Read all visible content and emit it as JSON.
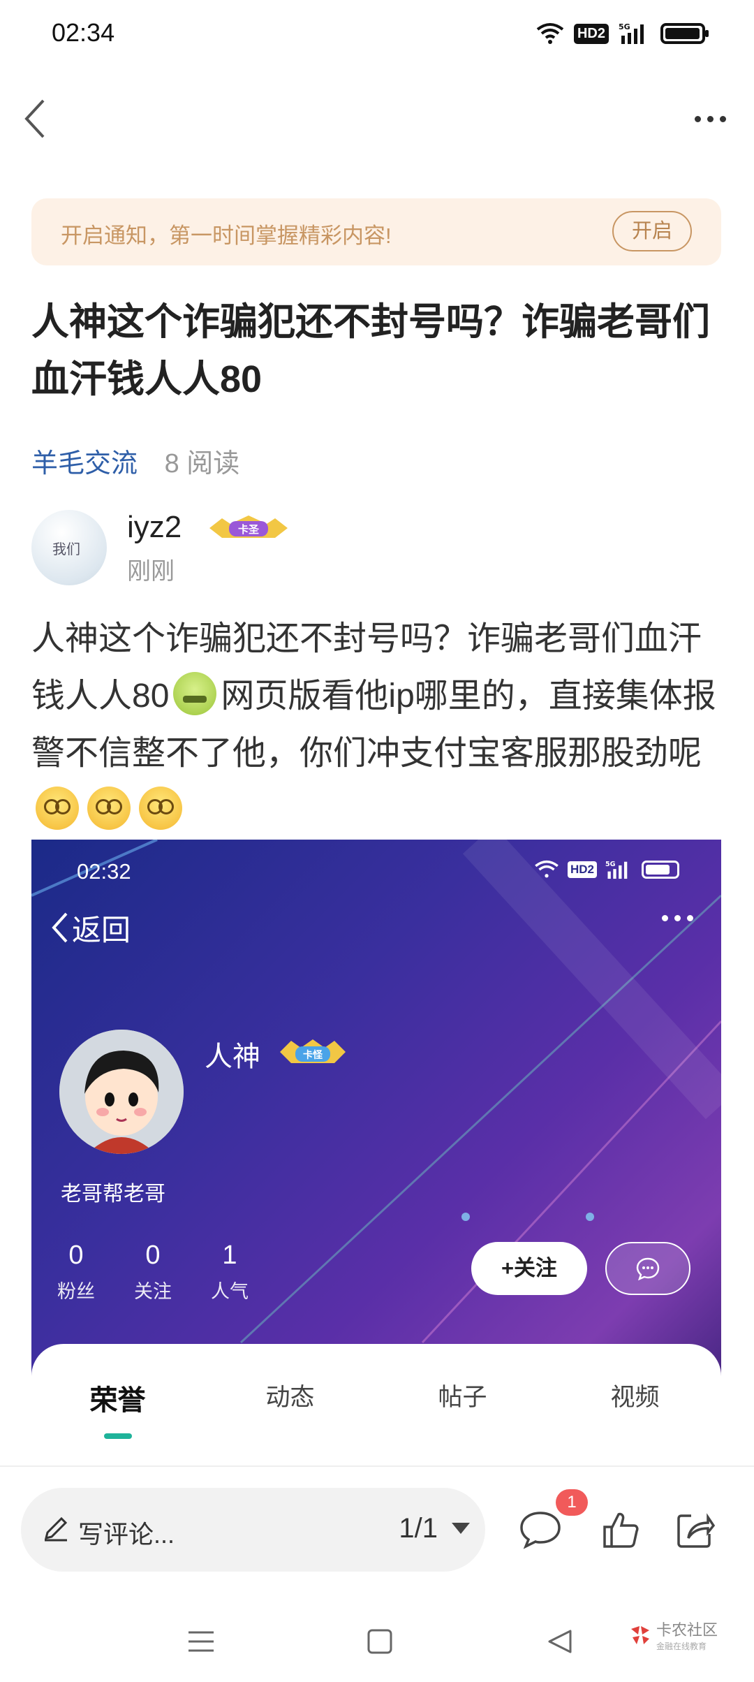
{
  "status_bar": {
    "time": "02:34",
    "network": "5G",
    "hd_label": "HD2",
    "battery_level": 0.85
  },
  "nav": {
    "back_icon": "chevron-left-icon",
    "more_icon": "more-horizontal-icon"
  },
  "notice": {
    "text": "开启通知，第一时间掌握精彩内容!",
    "button": "开启"
  },
  "post": {
    "title": "人神这个诈骗犯还不封号吗？诈骗老哥们血汗钱人人80",
    "category": "羊毛交流",
    "reads": "8 阅读",
    "author": {
      "name": "iyz2",
      "badge_text": "卡圣",
      "time": "刚刚",
      "avatar_text": "我们"
    },
    "body_part1": "人神这个诈骗犯还不封号吗？诈骗老哥们血汗钱人人80",
    "body_part2": "网页版看他ip哪里的，直接集体报警不信整不了他，你们冲支付宝客服那股劲呢"
  },
  "screenshot": {
    "time": "02:32",
    "back_label": "返回",
    "hd_label": "HD2",
    "network": "5G",
    "username": "人神",
    "badge_text": "卡怪",
    "signature": "老哥帮老哥",
    "stats": [
      {
        "value": "0",
        "label": "粉丝"
      },
      {
        "value": "0",
        "label": "关注"
      },
      {
        "value": "1",
        "label": "人气"
      }
    ],
    "follow_button": "+关注",
    "tabs": [
      "荣誉",
      "动态",
      "帖子",
      "视频"
    ],
    "active_tab": "荣誉"
  },
  "bottom_bar": {
    "comment_placeholder": "写评论...",
    "pager": "1/1",
    "comment_count": "1"
  },
  "watermark": {
    "text": "卡农社区",
    "sub": "金融在线教育"
  },
  "colors": {
    "notice_bg": "#fdf1e6",
    "notice_text": "#c89663",
    "category": "#2e5ea8",
    "tab_indicator": "#1fb39a",
    "badge": "#f15a5a"
  }
}
